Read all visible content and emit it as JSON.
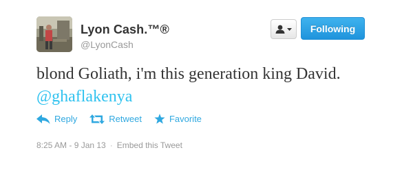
{
  "user": {
    "display_name": "Lyon Cash.™®",
    "handle": "@LyonCash",
    "avatar_icon": "profile-photo"
  },
  "header": {
    "user_actions_icon": "user-icon",
    "follow_button_label": "Following",
    "follow_button_color": "#2ea0e6"
  },
  "tweet": {
    "text_before_mention": "blond Goliath, i'm this generation king David. ",
    "mention": "@ghaflakenya",
    "mention_color": "#2fc2ef"
  },
  "actions": [
    {
      "label": "Reply",
      "icon": "reply-icon"
    },
    {
      "label": "Retweet",
      "icon": "retweet-icon"
    },
    {
      "label": "Favorite",
      "icon": "star-icon"
    }
  ],
  "footer": {
    "timestamp": "8:25 AM - 9 Jan 13",
    "separator": "·",
    "embed_label": "Embed this Tweet"
  }
}
